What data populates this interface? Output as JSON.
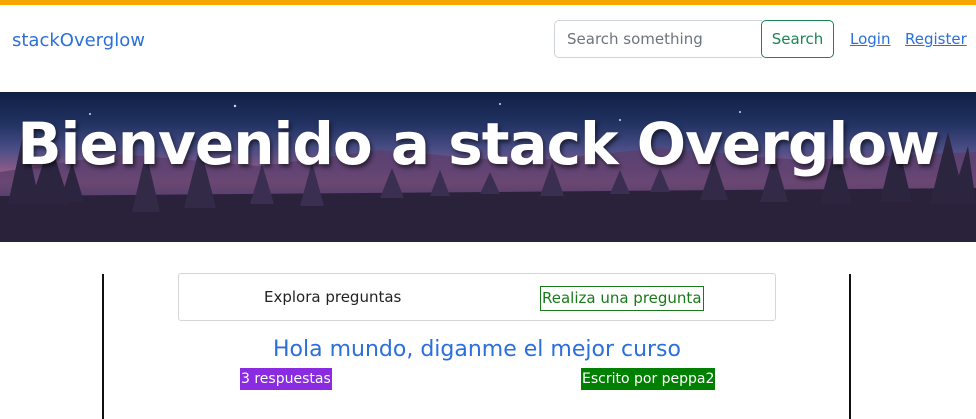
{
  "navbar": {
    "brand": "stackOverglow",
    "search_placeholder": "Search something",
    "search_button": "Search",
    "login": "Login",
    "register": "Register"
  },
  "hero": {
    "title": "Bienvenido a stack Overglow"
  },
  "tabs": {
    "explore": "Explora preguntas",
    "ask": "Realiza una pregunta"
  },
  "question": {
    "title": "Hola mundo, diganme el mejor curso",
    "answers": "3 respuestas",
    "author": "Escrito por peppa2"
  },
  "colors": {
    "accent_bar": "#f7a600",
    "link": "#2a6fdb",
    "search_button": "#198754",
    "answers_badge": "#8a2be2",
    "author_badge": "#008000"
  }
}
